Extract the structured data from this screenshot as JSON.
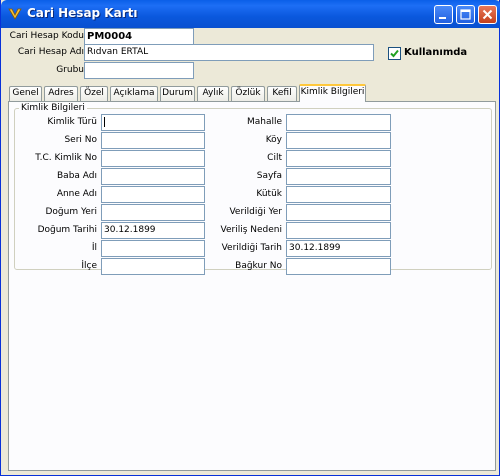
{
  "window": {
    "title": "Cari Hesap Kartı"
  },
  "header": {
    "kod_label": "Cari Hesap Kodu",
    "kod_value": "PM0004",
    "adi_label": "Cari Hesap Adı",
    "adi_value": "Rıdvan ERTAL",
    "grubu_label": "Grubu",
    "grubu_value": "",
    "kullanimda_label": "Kullanımda",
    "kullanimda_checked": true
  },
  "tabs": [
    {
      "label": "Genel"
    },
    {
      "label": "Adres"
    },
    {
      "label": "Özel"
    },
    {
      "label": "Açıklama"
    },
    {
      "label": "Durum"
    },
    {
      "label": "Aylık"
    },
    {
      "label": "Özlük"
    },
    {
      "label": "Kefil"
    },
    {
      "label": "Kimlik Bilgileri",
      "active": true
    }
  ],
  "kimlik": {
    "group_title": "Kimlik Bilgileri",
    "left": [
      {
        "label": "Kimlik Türü",
        "value": ""
      },
      {
        "label": "Seri No",
        "value": ""
      },
      {
        "label": "T.C. Kimlik No",
        "value": ""
      },
      {
        "label": "Baba Adı",
        "value": ""
      },
      {
        "label": "Anne Adı",
        "value": ""
      },
      {
        "label": "Doğum Yeri",
        "value": ""
      },
      {
        "label": "Doğum Tarihi",
        "value": "30.12.1899"
      },
      {
        "label": "İl",
        "value": ""
      },
      {
        "label": "İlçe",
        "value": ""
      }
    ],
    "right": [
      {
        "label": "Mahalle",
        "value": ""
      },
      {
        "label": "Köy",
        "value": ""
      },
      {
        "label": "Cilt",
        "value": ""
      },
      {
        "label": "Sayfa",
        "value": ""
      },
      {
        "label": "Kütük",
        "value": ""
      },
      {
        "label": "Verildiği Yer",
        "value": ""
      },
      {
        "label": "Veriliş Nedeni",
        "value": ""
      },
      {
        "label": "Verildiği Tarih",
        "value": "30.12.1899"
      },
      {
        "label": "Bağkur No",
        "value": ""
      }
    ]
  },
  "colors": {
    "titlebar": "#0a5fe8",
    "window_bg": "#ece9d8",
    "tab_highlight": "#ffc83c"
  },
  "icons": [
    "app-icon",
    "minimize-icon",
    "maximize-icon",
    "close-icon",
    "checkmark-icon"
  ]
}
